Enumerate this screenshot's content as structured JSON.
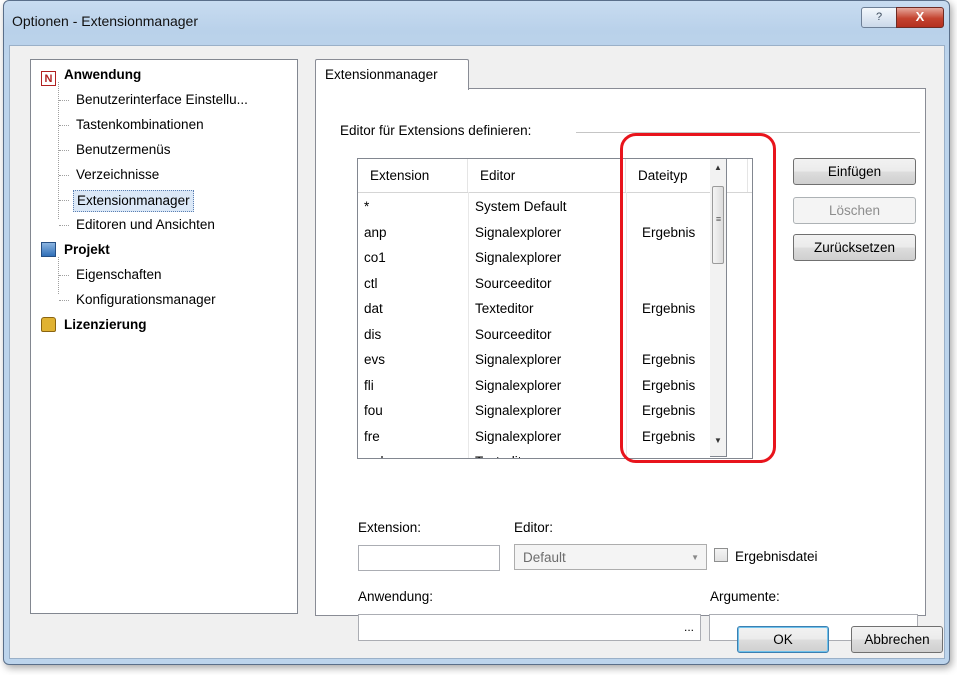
{
  "window": {
    "title": "Optionen - Extensionmanager",
    "help_label": "?",
    "close_label": "X"
  },
  "tree": {
    "groups": [
      {
        "label": "Anwendung",
        "icon": "n-icon",
        "children": [
          "Benutzerinterface Einstellu...",
          "Tastenkombinationen",
          "Benutzermenüs",
          "Verzeichnisse",
          "Extensionmanager",
          "Editoren und Ansichten"
        ]
      },
      {
        "label": "Projekt",
        "icon": "project-icon",
        "children": [
          "Eigenschaften",
          "Konfigurationsmanager"
        ]
      },
      {
        "label": "Lizenzierung",
        "icon": "lock-icon",
        "children": []
      }
    ],
    "selected": "Extensionmanager"
  },
  "tab": {
    "label": "Extensionmanager"
  },
  "group_label": "Editor für Extensions definieren:",
  "table": {
    "columns": [
      "Extension",
      "Editor",
      "Dateityp"
    ],
    "rows": [
      [
        "*",
        "System Default",
        ""
      ],
      [
        "anp",
        "Signalexplorer",
        "Ergebnis"
      ],
      [
        "co1",
        "Signalexplorer",
        ""
      ],
      [
        "ctl",
        "Sourceeditor",
        ""
      ],
      [
        "dat",
        "Texteditor",
        "Ergebnis"
      ],
      [
        "dis",
        "Sourceeditor",
        ""
      ],
      [
        "evs",
        "Signalexplorer",
        "Ergebnis"
      ],
      [
        "fli",
        "Signalexplorer",
        "Ergebnis"
      ],
      [
        "fou",
        "Signalexplorer",
        "Ergebnis"
      ],
      [
        "fre",
        "Signalexplorer",
        "Ergebnis"
      ],
      [
        "grd",
        "Texteditor",
        ""
      ]
    ]
  },
  "side_buttons": {
    "insert": "Einfügen",
    "delete": "Löschen",
    "reset": "Zurücksetzen"
  },
  "form": {
    "extension_label": "Extension:",
    "extension_value": "",
    "editor_label": "Editor:",
    "editor_value": "Default",
    "result_file_label": "Ergebnisdatei",
    "application_label": "Anwendung:",
    "application_value": "",
    "browse_label": "...",
    "arguments_label": "Argumente:",
    "arguments_value": ""
  },
  "footer": {
    "ok": "OK",
    "cancel": "Abbrechen"
  },
  "colors": {
    "highlight": "#e8141c",
    "selection": "#dbe8f7"
  }
}
